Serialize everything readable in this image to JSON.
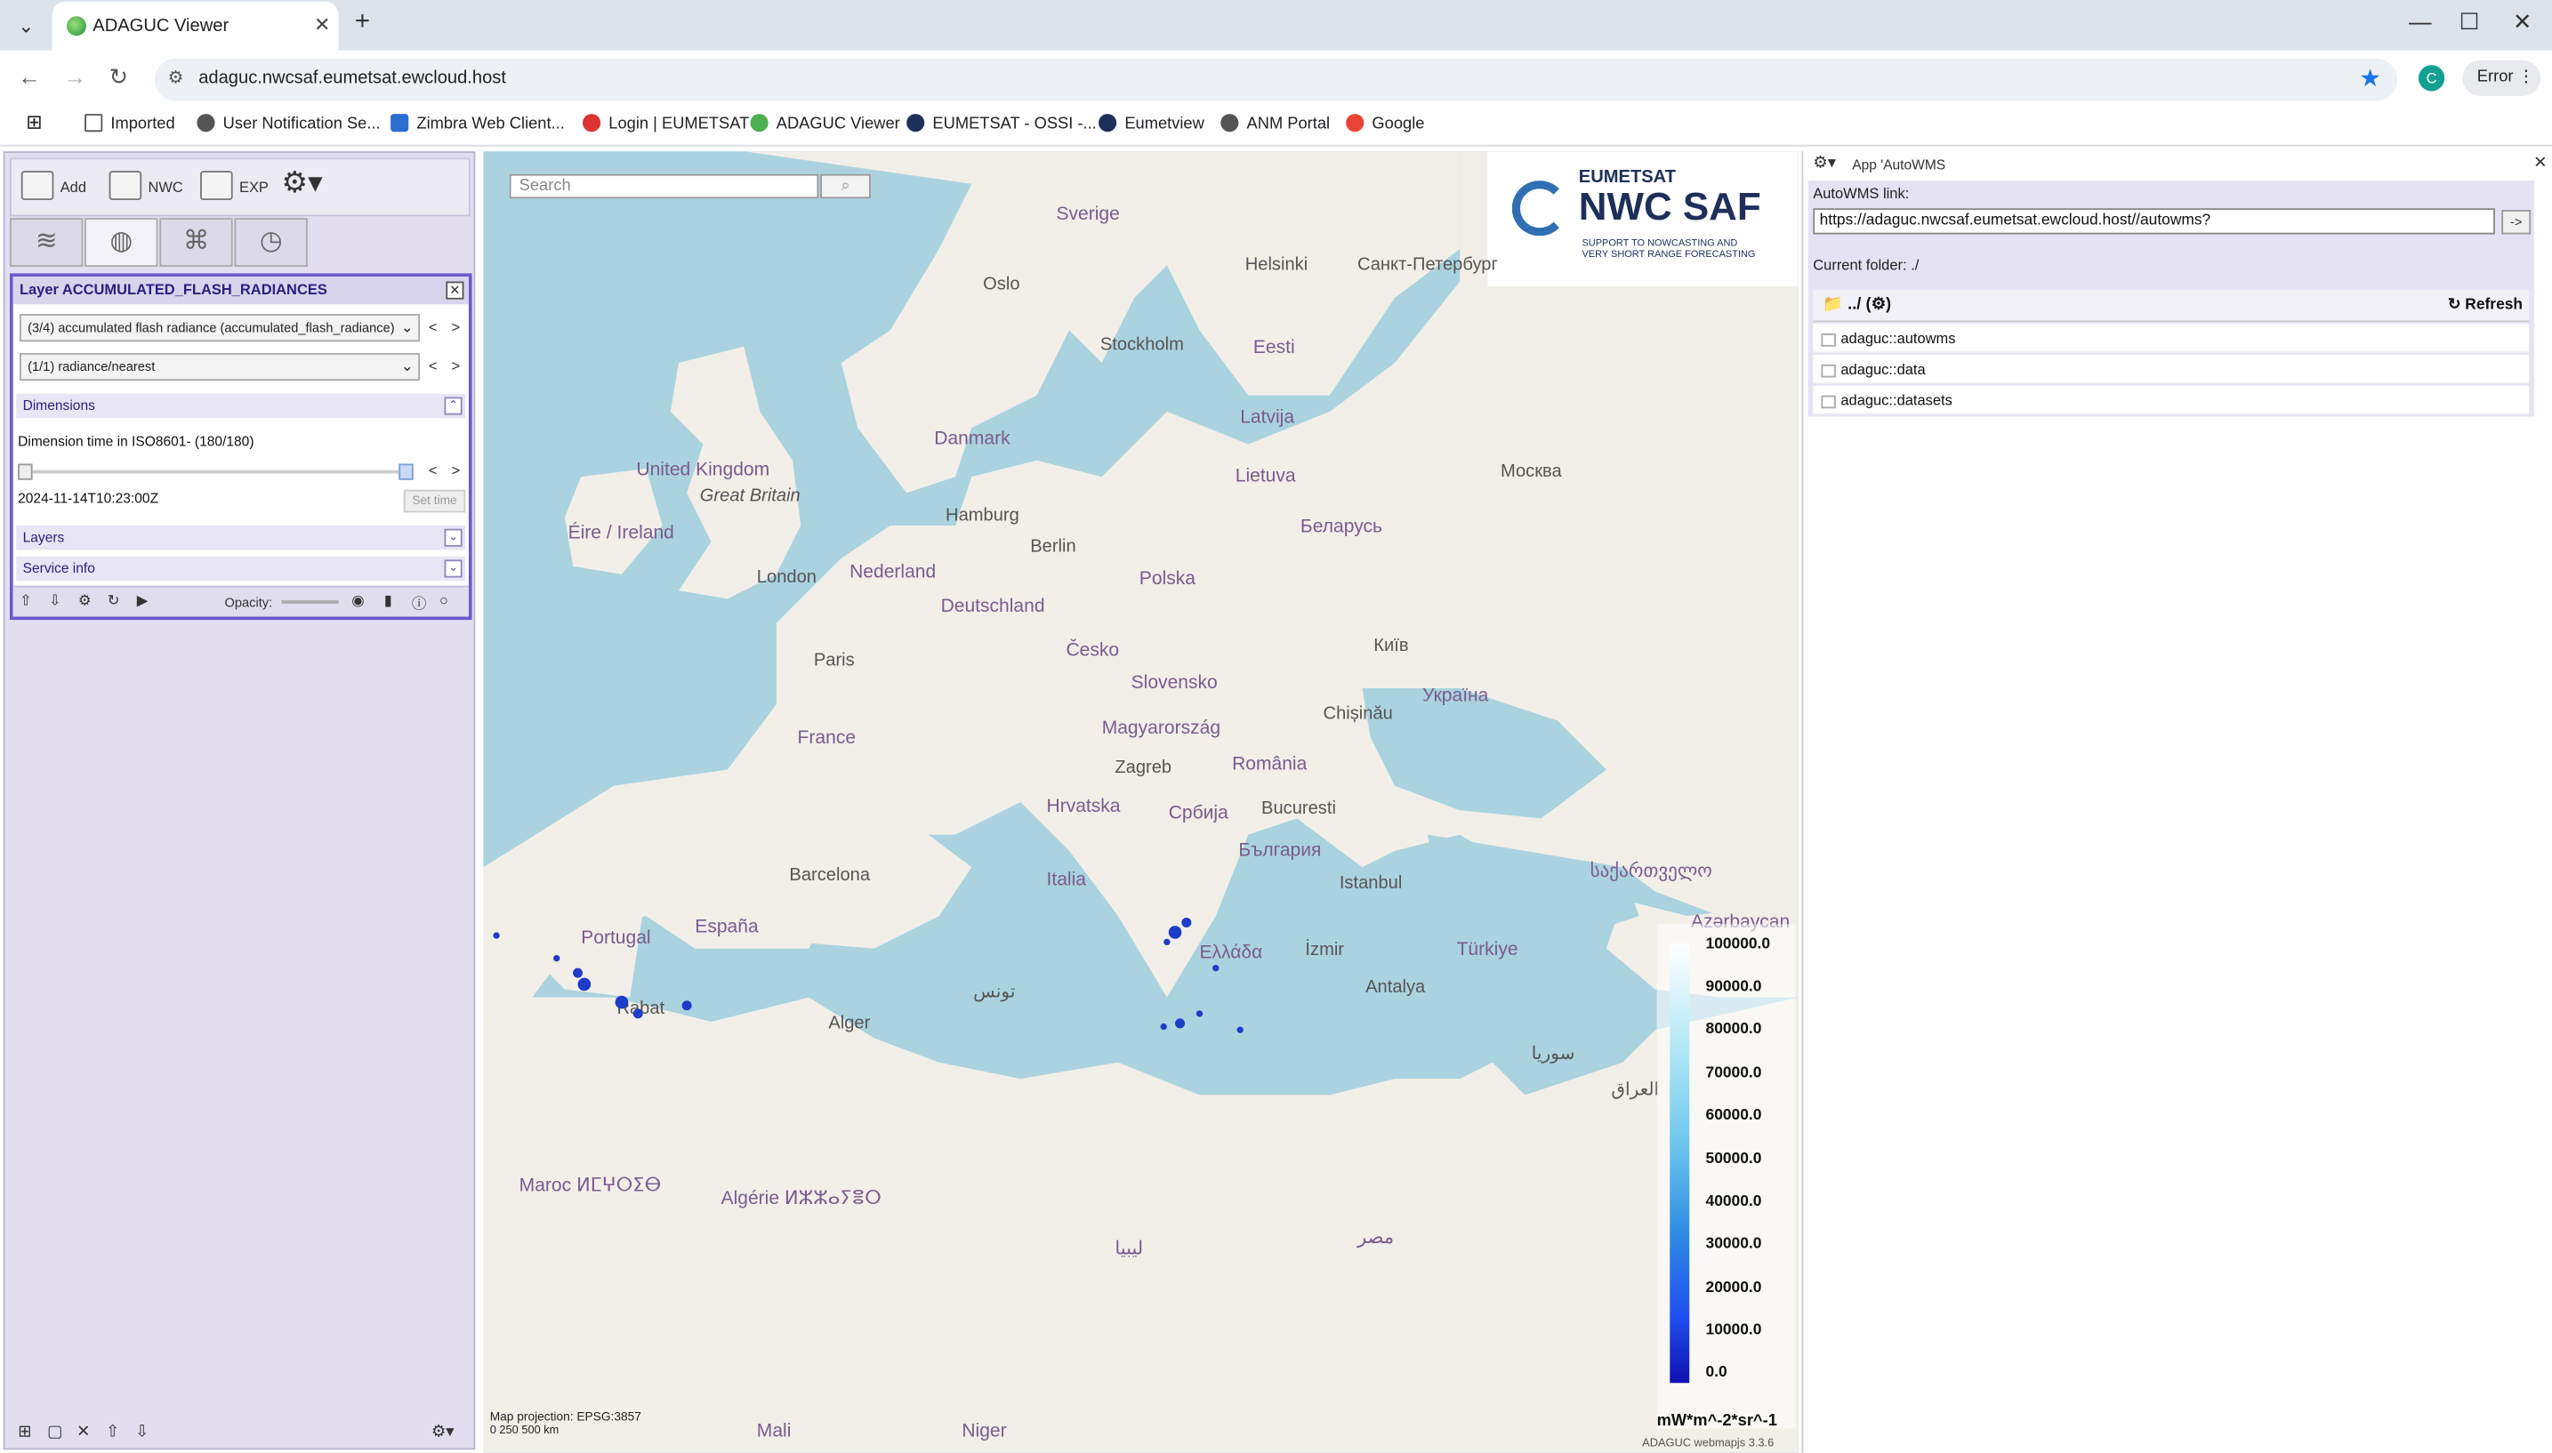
{
  "browser": {
    "tab_title": "ADAGUC Viewer",
    "url": "adaguc.nwcsaf.eumetsat.ewcloud.host",
    "profile_initial": "C",
    "error_label": "Error"
  },
  "bookmarks": [
    {
      "label": "Imported"
    },
    {
      "label": "User Notification Se..."
    },
    {
      "label": "Zimbra Web Client..."
    },
    {
      "label": "Login | EUMETSAT"
    },
    {
      "label": "ADAGUC Viewer"
    },
    {
      "label": "EUMETSAT - OSSI -..."
    },
    {
      "label": "Eumetview"
    },
    {
      "label": "ANM Portal"
    },
    {
      "label": "Google"
    }
  ],
  "toolbar": {
    "add": "Add",
    "nwc": "NWC",
    "exp": "EXP"
  },
  "layer": {
    "title": "Layer ACCUMULATED_FLASH_RADIANCES",
    "select1": "(3/4) accumulated flash radiance (accumulated_flash_radiance)",
    "select2": "(1/1) radiance/nearest",
    "dimensions_label": "Dimensions",
    "dim_text": "Dimension time in ISO8601- (180/180)",
    "time_value": "2024-11-14T10:23:00Z",
    "set_time": "Set time",
    "layers_label": "Layers",
    "service_label": "Service info",
    "opacity_label": "Opacity:"
  },
  "map": {
    "search_placeholder": "Search",
    "logo": {
      "top": "EUMETSAT",
      "main": "NWC SAF",
      "sub1": "SUPPORT TO NOWCASTING AND",
      "sub2": "VERY SHORT RANGE FORECASTING"
    },
    "projection": "Map projection: EPSG:3857",
    "scale_text": "0  250  500 km",
    "version": "ADAGUC webmapjs 3.3.6",
    "legend_values": [
      "100000.0",
      "90000.0",
      "80000.0",
      "70000.0",
      "60000.0",
      "50000.0",
      "40000.0",
      "30000.0",
      "20000.0",
      "10000.0",
      "0.0"
    ],
    "legend_unit": "mW*m^-2*sr^-1",
    "labels": [
      "Sverige",
      "Oslo",
      "Helsinki",
      "Санкт-Петербург",
      "Stockholm",
      "Eesti",
      "Latvija",
      "Danmark",
      "United Kingdom",
      "Great Britain",
      "Lietuva",
      "Москва",
      "Éire / Ireland",
      "Hamburg",
      "Berlin",
      "Беларусь",
      "Nederland",
      "London",
      "Polska",
      "Deutschland",
      "Paris",
      "Česko",
      "Київ",
      "Slovensko",
      "Україна",
      "France",
      "Magyarország",
      "Chișinău",
      "Zagreb",
      "România",
      "Hrvatska",
      "Србија",
      "Bucuresti",
      "България",
      "Barcelona",
      "Italia",
      "Istanbul",
      "Portugal",
      "España",
      "საქართველო",
      "Azərbaycan",
      "Türkiye",
      "Ελλάδα",
      "İzmir",
      "Antalya",
      "Rabat",
      "Alger",
      "تونس",
      "سوريا",
      "العراق",
      "Maroc ⵍⵎⵖⵔⵉⴱ",
      "Algérie ⵍⵣⵣⴰⵢⴻⵔ",
      "ليبيا",
      "مصر",
      "Mali",
      "Niger"
    ]
  },
  "autowms": {
    "panel_title": "App 'AutoWMS",
    "link_label": "AutoWMS link:",
    "link_value": "https://adaguc.nwcsaf.eumetsat.ewcloud.host//autowms?",
    "go_label": "->",
    "current_folder": "Current folder: ./",
    "up_label": "../ (⚙)",
    "refresh_label": "↻ Refresh",
    "items": [
      "adaguc::autowms",
      "adaguc::data",
      "adaguc::datasets"
    ]
  }
}
